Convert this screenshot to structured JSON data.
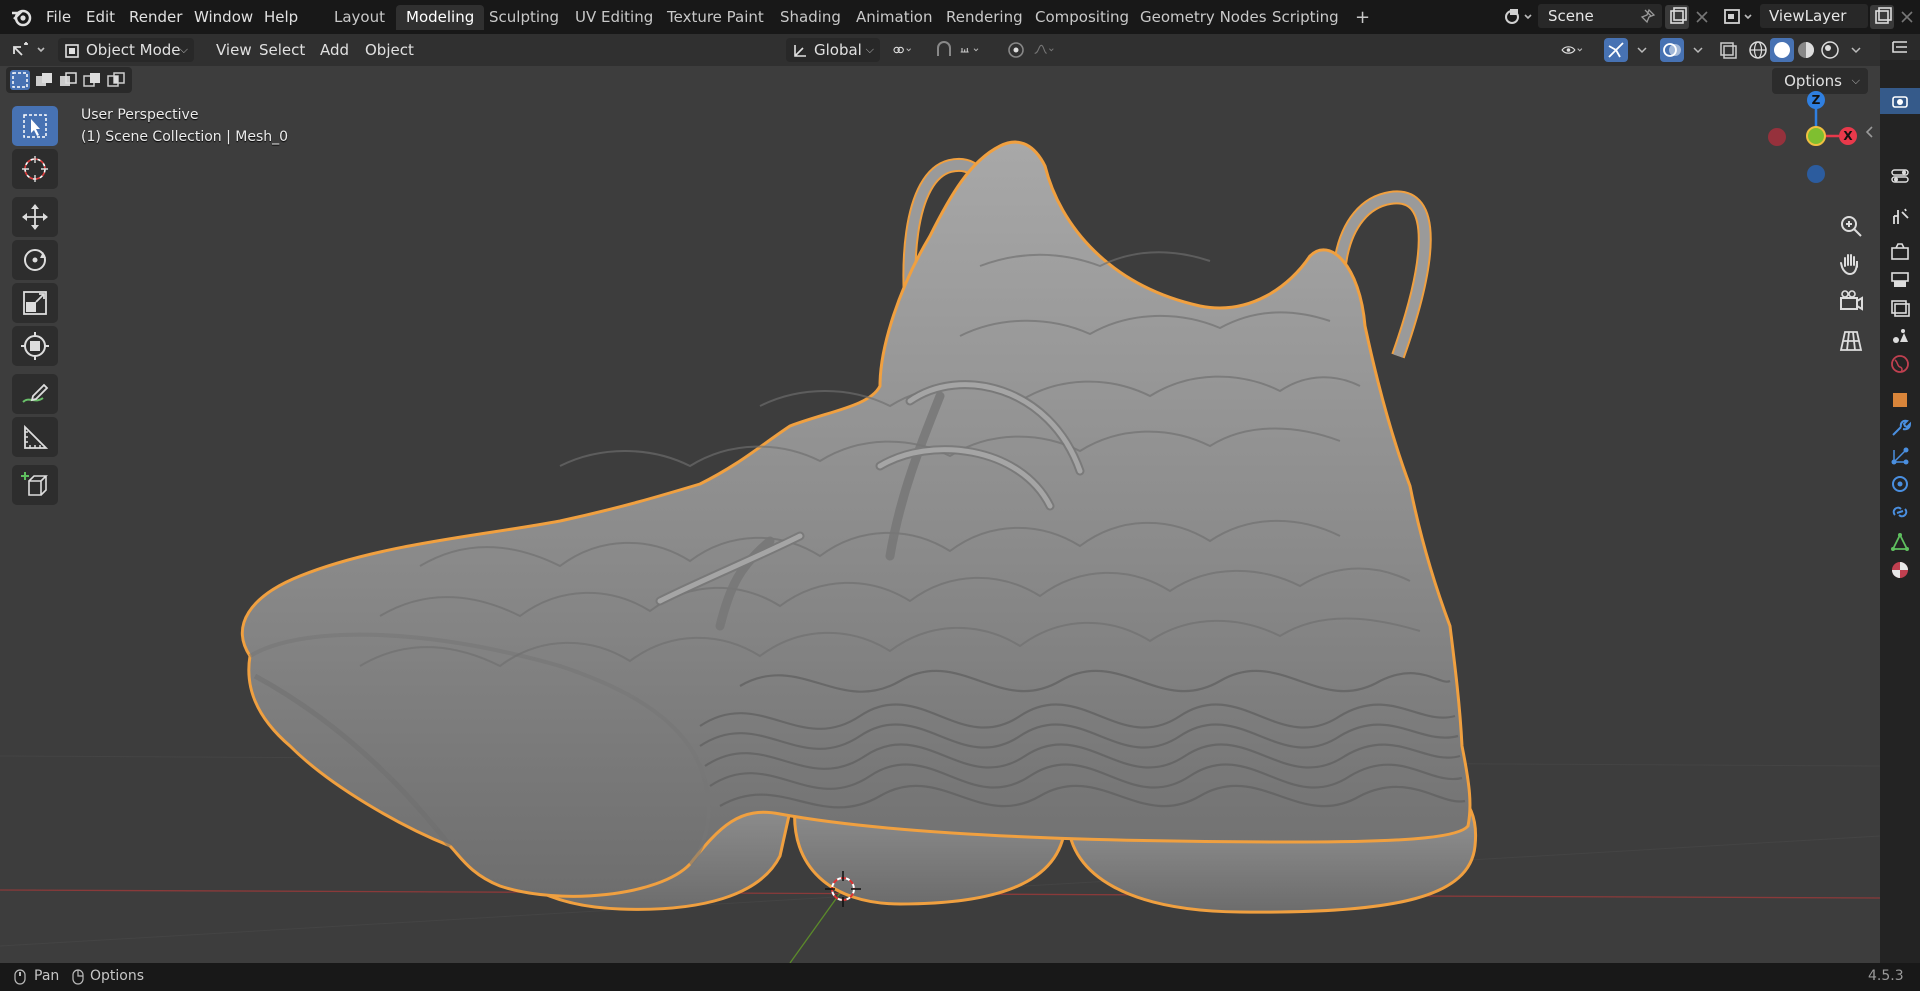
{
  "menu": {
    "items": [
      "File",
      "Edit",
      "Render",
      "Window",
      "Help"
    ]
  },
  "workspaces": {
    "tabs": [
      "Layout",
      "Modeling",
      "Sculpting",
      "UV Editing",
      "Texture Paint",
      "Shading",
      "Animation",
      "Rendering",
      "Compositing",
      "Geometry Nodes",
      "Scripting"
    ],
    "active": "Modeling",
    "add_label": "+"
  },
  "scene": {
    "name": "Scene"
  },
  "view_layer": {
    "name": "ViewLayer"
  },
  "header": {
    "mode": "Object Mode",
    "menus": [
      "View",
      "Select",
      "Add",
      "Object"
    ],
    "orientation": "Global",
    "options_label": "Options"
  },
  "viewport": {
    "perspective_label": "User Perspective",
    "collection_label": "(1) Scene Collection | Mesh_0",
    "background_color": "#3d3d3d",
    "selection_outline_color": "#f0a040",
    "mesh_color": "#8c8c8c"
  },
  "gizmo": {
    "axes": [
      {
        "name": "Z",
        "color": "#2f7fe0"
      },
      {
        "name": "X",
        "color": "#e8394b"
      },
      {
        "name": "Y",
        "color": "#7fbf30"
      }
    ]
  },
  "nav_buttons": [
    "zoom-icon",
    "hand-pan-icon",
    "camera-icon",
    "grid-ortho-icon"
  ],
  "toolbar": {
    "tools": [
      "select-box-icon",
      "cursor-icon",
      "move-icon",
      "rotate-icon",
      "scale-icon",
      "transform-icon",
      "annotate-icon",
      "measure-icon",
      "add-cube-icon"
    ],
    "active": "select-box-icon"
  },
  "statusbar": {
    "pan_label": "Pan",
    "options_label": "Options",
    "version": "4.5.3"
  },
  "properties_tabs": [
    "tool-icon",
    "render-icon",
    "output-icon",
    "view-layer-icon",
    "scene-icon",
    "world-icon",
    "object-icon",
    "modifier-icon",
    "particles-icon",
    "physics-icon",
    "constraints-icon",
    "data-icon",
    "material-icon"
  ]
}
